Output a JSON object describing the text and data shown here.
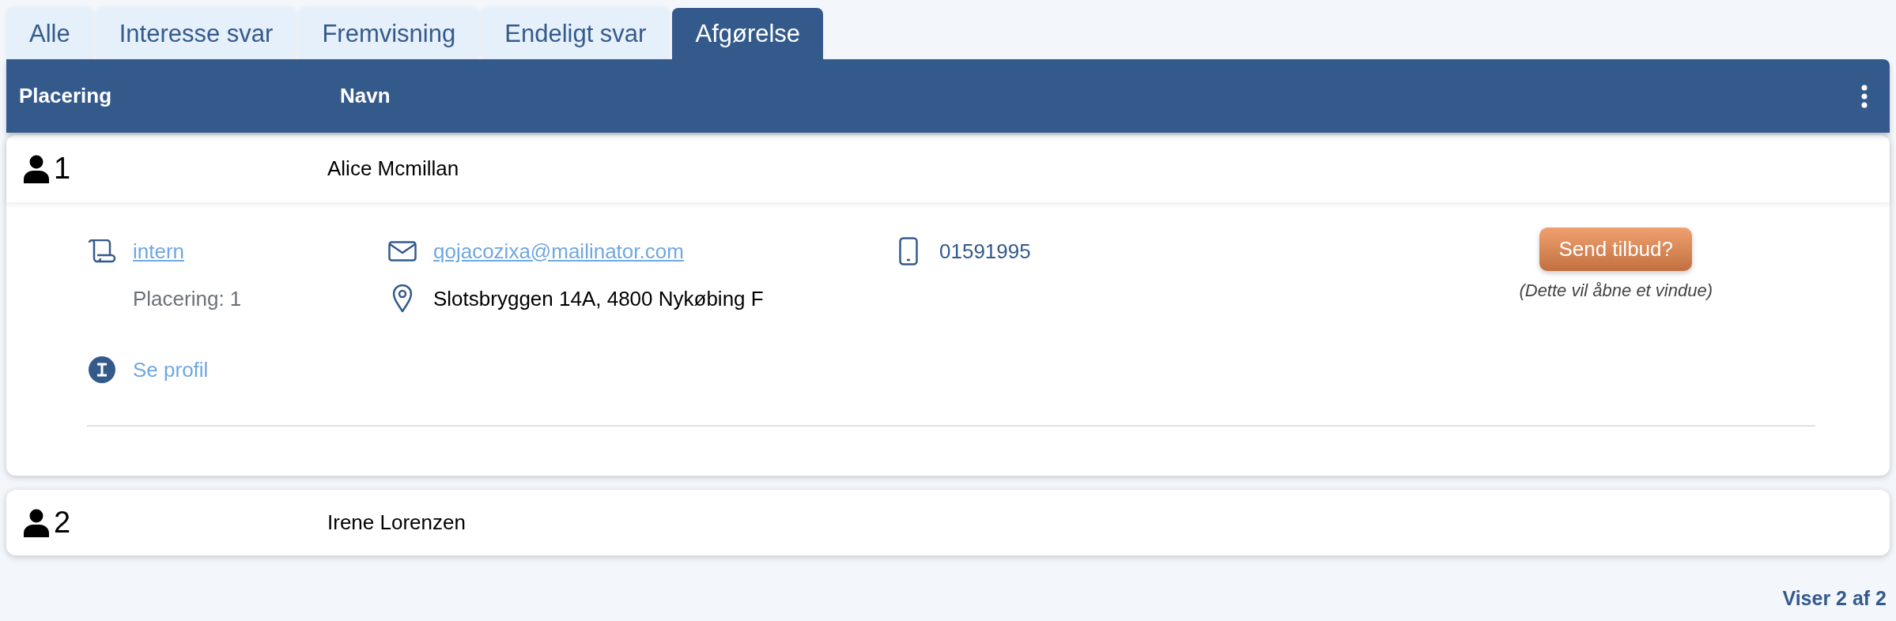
{
  "tabs": [
    {
      "label": "Alle",
      "selected": false
    },
    {
      "label": "Interesse svar",
      "selected": false
    },
    {
      "label": "Fremvisning",
      "selected": false
    },
    {
      "label": "Endeligt svar",
      "selected": false
    },
    {
      "label": "Afgørelse",
      "selected": true
    }
  ],
  "table": {
    "columns": [
      "Placering",
      "Navn"
    ],
    "rows": [
      {
        "placement": "1",
        "name": "Alice Mcmillan",
        "expanded": true,
        "details": {
          "source": "intern",
          "placement_label": "Placering: 1",
          "profile_link": "Se profil",
          "email": "qojacozixa@mailinator.com",
          "address": "Slotsbryggen 14A, 4800 Nykøbing F",
          "phone": "01591995",
          "action_button": "Send tilbud?",
          "action_note": "(Dette vil åbne et vindue)"
        }
      },
      {
        "placement": "2",
        "name": "Irene Lorenzen",
        "expanded": false
      }
    ]
  },
  "footer": "Viser 2 af 2"
}
